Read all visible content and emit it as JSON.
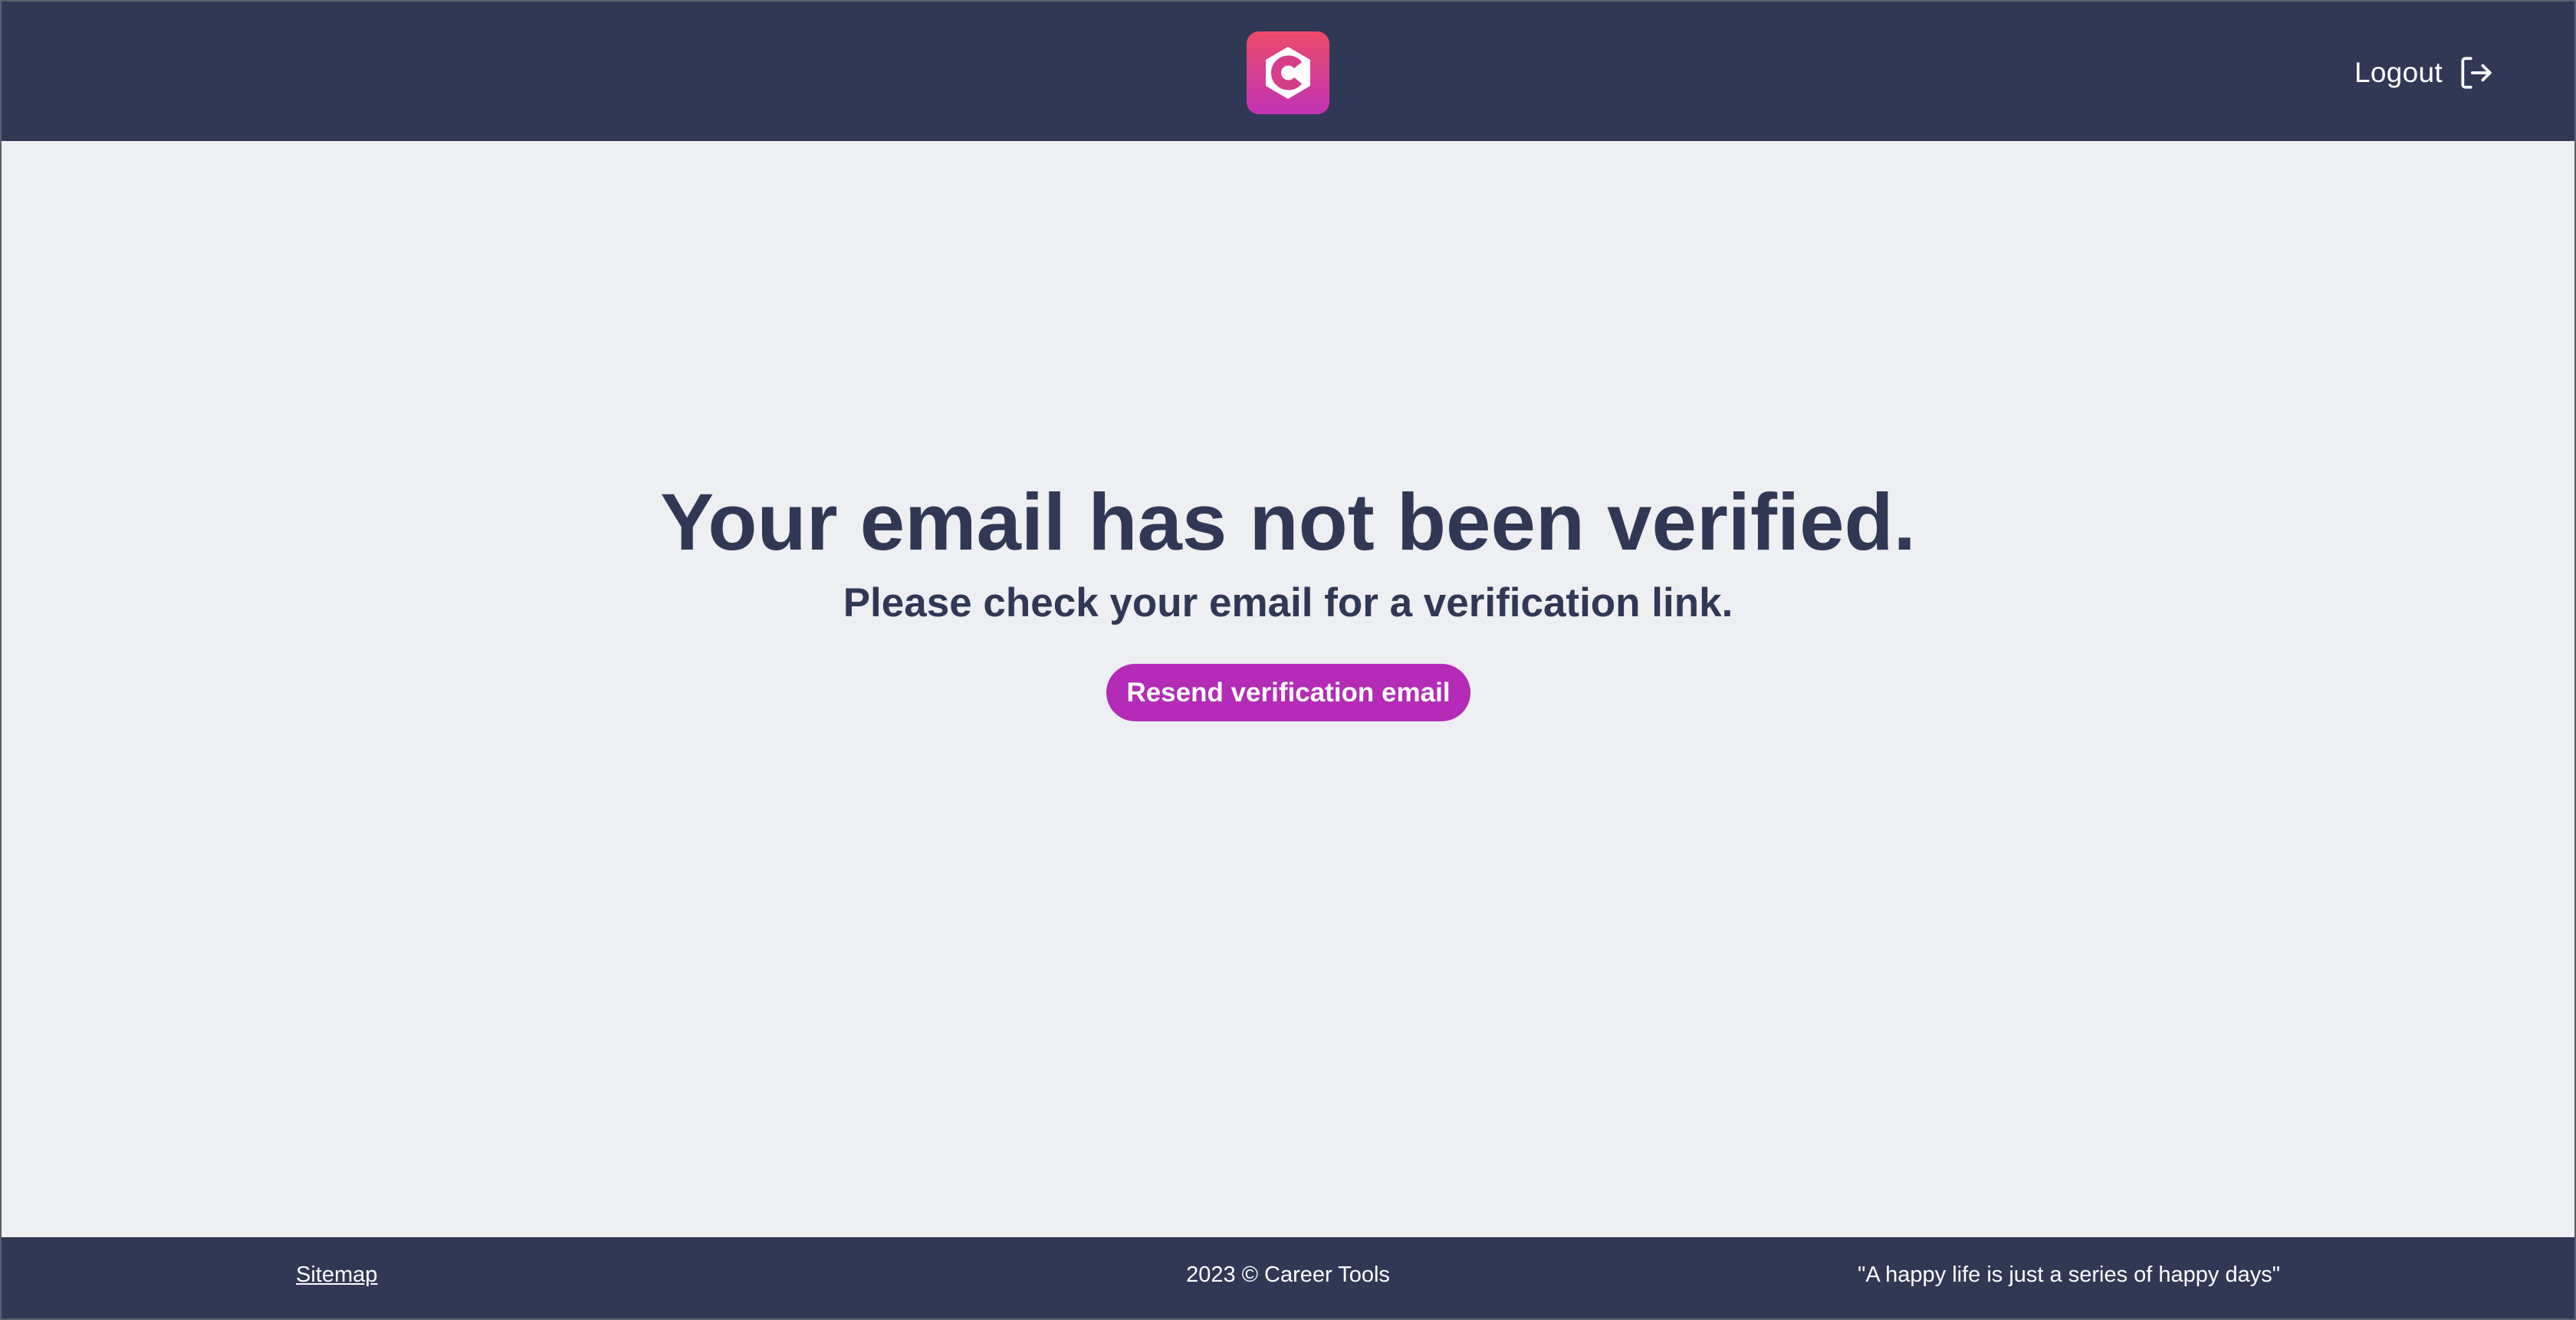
{
  "header": {
    "logo_alt": "Career Tools logo",
    "logout_label": "Logout",
    "logout_icon": "logout-icon"
  },
  "main": {
    "headline": "Your email has not been verified.",
    "subline": "Please check your email for a verification link.",
    "resend_label": "Resend verification email"
  },
  "footer": {
    "sitemap_label": "Sitemap",
    "copyright": "2023 © Career Tools",
    "quote": "\"A happy life is just a series of happy days\""
  },
  "colors": {
    "header_bg": "#313855",
    "page_bg": "#edeff3",
    "primary_text": "#313855",
    "accent": "#b32bb6",
    "logo_gradient_top": "#ec4a6a",
    "logo_gradient_bottom": "#c133b5"
  }
}
